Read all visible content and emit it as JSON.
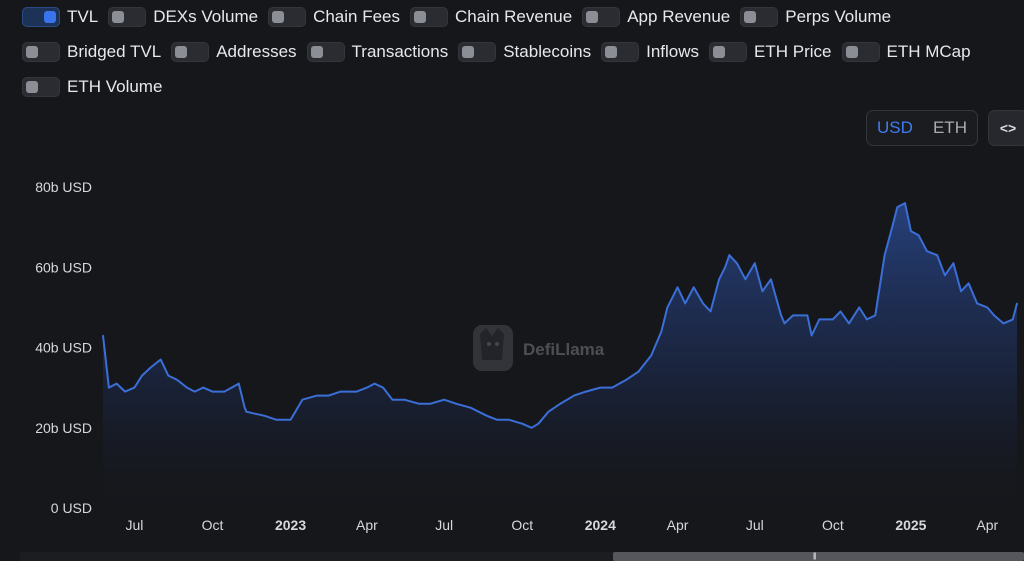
{
  "toggles": [
    {
      "label": "TVL",
      "on": true
    },
    {
      "label": "DEXs Volume",
      "on": false
    },
    {
      "label": "Chain Fees",
      "on": false
    },
    {
      "label": "Chain Revenue",
      "on": false
    },
    {
      "label": "App Revenue",
      "on": false
    },
    {
      "label": "Perps Volume",
      "on": false
    },
    {
      "label": "Bridged TVL",
      "on": false
    },
    {
      "label": "Addresses",
      "on": false
    },
    {
      "label": "Transactions",
      "on": false
    },
    {
      "label": "Stablecoins",
      "on": false
    },
    {
      "label": "Inflows",
      "on": false
    },
    {
      "label": "ETH Price",
      "on": false
    },
    {
      "label": "ETH MCap",
      "on": false
    },
    {
      "label": "ETH Volume",
      "on": false
    }
  ],
  "denomination": {
    "options": [
      "USD",
      "ETH"
    ],
    "selected": "USD"
  },
  "embed_label": "<>",
  "watermark": "DefiLlama",
  "colors": {
    "line": "#3b6fd8",
    "accent": "#3f7cf0",
    "background": "#16171b"
  },
  "chart_data": {
    "type": "area",
    "series": [
      {
        "name": "TVL",
        "unit": "b USD",
        "x": [
          "2022-05-25",
          "2022-06-01",
          "2022-06-10",
          "2022-06-20",
          "2022-07-01",
          "2022-07-10",
          "2022-07-20",
          "2022-08-01",
          "2022-08-10",
          "2022-08-20",
          "2022-09-01",
          "2022-09-10",
          "2022-09-20",
          "2022-10-01",
          "2022-10-15",
          "2022-11-01",
          "2022-11-08",
          "2022-11-10",
          "2022-11-20",
          "2022-12-01",
          "2022-12-15",
          "2023-01-01",
          "2023-01-15",
          "2023-02-01",
          "2023-02-15",
          "2023-03-01",
          "2023-03-10",
          "2023-03-20",
          "2023-04-01",
          "2023-04-10",
          "2023-04-20",
          "2023-05-01",
          "2023-05-15",
          "2023-06-01",
          "2023-06-15",
          "2023-07-01",
          "2023-07-15",
          "2023-08-01",
          "2023-08-20",
          "2023-09-01",
          "2023-09-15",
          "2023-10-01",
          "2023-10-12",
          "2023-10-20",
          "2023-11-01",
          "2023-11-15",
          "2023-12-01",
          "2023-12-15",
          "2024-01-01",
          "2024-01-15",
          "2024-02-01",
          "2024-02-15",
          "2024-03-01",
          "2024-03-13",
          "2024-03-20",
          "2024-04-01",
          "2024-04-10",
          "2024-04-20",
          "2024-05-01",
          "2024-05-10",
          "2024-05-20",
          "2024-05-27",
          "2024-06-01",
          "2024-06-10",
          "2024-06-20",
          "2024-07-01",
          "2024-07-10",
          "2024-07-20",
          "2024-08-01",
          "2024-08-05",
          "2024-08-15",
          "2024-09-01",
          "2024-09-06",
          "2024-09-15",
          "2024-10-01",
          "2024-10-10",
          "2024-10-20",
          "2024-11-01",
          "2024-11-10",
          "2024-11-20",
          "2024-12-01",
          "2024-12-10",
          "2024-12-16",
          "2024-12-25",
          "2025-01-01",
          "2025-01-10",
          "2025-01-20",
          "2025-02-01",
          "2025-02-10",
          "2025-02-20",
          "2025-03-01",
          "2025-03-10",
          "2025-03-20",
          "2025-04-01",
          "2025-04-09",
          "2025-04-20",
          "2025-05-01",
          "2025-05-06"
        ],
        "values": [
          43,
          30,
          31,
          29,
          30,
          33,
          35,
          37,
          33,
          32,
          30,
          29,
          30,
          29,
          29,
          31,
          25,
          24,
          23.5,
          23,
          22,
          22,
          27,
          28,
          28,
          29,
          29,
          29,
          30,
          31,
          30,
          27,
          27,
          26,
          26,
          27,
          26,
          25,
          23,
          22,
          22,
          21,
          20,
          21,
          24,
          26,
          28,
          29,
          30,
          30,
          32,
          34,
          38,
          44,
          50,
          55,
          51,
          55,
          51,
          49,
          57,
          60,
          63,
          61,
          57,
          61,
          54,
          57,
          48,
          46,
          48,
          48,
          43,
          47,
          47,
          49,
          46,
          50,
          47,
          48,
          63,
          70,
          75,
          76,
          69,
          68,
          64,
          63,
          58,
          61,
          54,
          56,
          51,
          50,
          48,
          46,
          47,
          51
        ]
      }
    ],
    "xlabels": [
      "Jul",
      "Oct",
      "2023",
      "Apr",
      "Jul",
      "Oct",
      "2024",
      "Apr",
      "Jul",
      "Oct",
      "2025",
      "Apr"
    ],
    "xlabel_dates": [
      "2022-07-01",
      "2022-10-01",
      "2023-01-01",
      "2023-04-01",
      "2023-07-01",
      "2023-10-01",
      "2024-01-01",
      "2024-04-01",
      "2024-07-01",
      "2024-10-01",
      "2025-01-01",
      "2025-04-01"
    ],
    "yticks": [
      0,
      20,
      40,
      60,
      80
    ],
    "ytick_labels": [
      "0 USD",
      "20b USD",
      "40b USD",
      "60b USD",
      "80b USD"
    ],
    "xrange": [
      "2022-05-25",
      "2025-05-06"
    ],
    "ylim": [
      0,
      80
    ],
    "grid": false,
    "legend": "none"
  }
}
